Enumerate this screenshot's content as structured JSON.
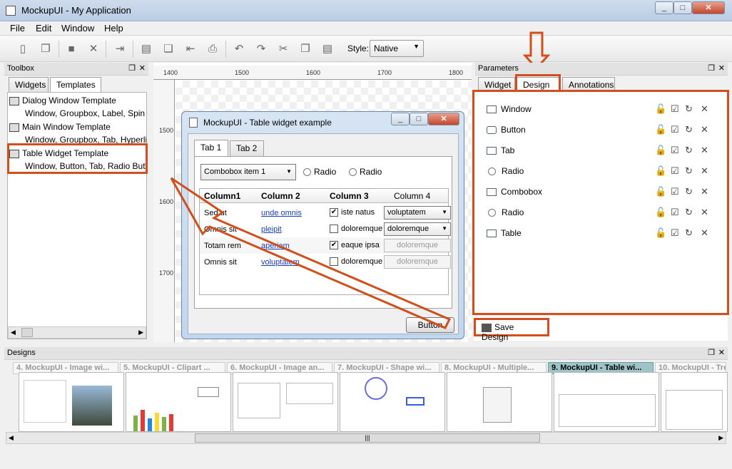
{
  "app": {
    "title": "MockupUI - My Application",
    "window_controls": [
      "_",
      "□",
      "✕"
    ]
  },
  "menu": [
    "File",
    "Edit",
    "Window",
    "Help"
  ],
  "toolbar": {
    "style_label": "Style:",
    "style_value": "Native",
    "icons": [
      "new-icon",
      "copy-icon",
      "save-icon",
      "close-icon",
      "export-icon",
      "paste-icon",
      "clone-icon",
      "import-icon",
      "print-icon",
      "undo-icon",
      "redo-icon",
      "cut-icon",
      "copy-icon",
      "paste-icon"
    ]
  },
  "toolbox": {
    "title": "Toolbox",
    "tabs": [
      "Widgets",
      "Templates"
    ],
    "templates": [
      {
        "name": "Dialog Window Template",
        "desc": "Window, Groupbox, Label, Spin Bo"
      },
      {
        "name": "Main Window Template",
        "desc": "Window, Groupbox, Tab, Hyperlink"
      },
      {
        "name": "Table Widget Template",
        "desc": "Window, Button, Tab, Radio Buttor"
      }
    ]
  },
  "ruler": {
    "h": [
      "1400",
      "1500",
      "1600",
      "1700",
      "1800"
    ],
    "v": [
      "1500",
      "1600",
      "1700"
    ]
  },
  "mock": {
    "title": "MockupUI - Table widget example",
    "tabs": [
      "Tab 1",
      "Tab 2"
    ],
    "combo": "Combobox item 1",
    "radio1": "Radio",
    "radio2": "Radio",
    "columns": [
      "Column1",
      "Column 2",
      "Column 3",
      "Column 4"
    ],
    "rows": [
      {
        "c1": "Sed ut",
        "c2": "unde omnis",
        "c3": "iste natus",
        "c3_checked": true,
        "c4": "voluptatem",
        "c4_enabled": true
      },
      {
        "c1": "Omnis sit",
        "c2": "pleipit",
        "c3": "doloremque",
        "c3_checked": false,
        "c4": "doloremque",
        "c4_enabled": true
      },
      {
        "c1": "Totam rem",
        "c2": "aperiam",
        "c3": "eaque ipsa",
        "c3_checked": true,
        "c4": "doloremque",
        "c4_enabled": false
      },
      {
        "c1": "Omnis sit",
        "c2": "voluptatem",
        "c3": "doloremque",
        "c3_checked": false,
        "c4": "doloremque",
        "c4_enabled": false
      }
    ],
    "button": "Button"
  },
  "parameters": {
    "title": "Parameters",
    "tabs": [
      "Widget",
      "Design",
      "Annotations"
    ],
    "items": [
      "Window",
      "Button",
      "Tab",
      "Radio",
      "Combobox",
      "Radio",
      "Table"
    ],
    "save_label": "Save Design"
  },
  "designs": {
    "title": "Designs",
    "tabs": [
      "4. MockupUI - Image wi...",
      "5. MockupUI - Clipart ...",
      "6. MockupUI - Image an...",
      "7. MockupUI - Shape wi...",
      "8. MockupUI - Multiple...",
      "9. MockupUI - Table wi...",
      "10. MockupUI - Tre"
    ],
    "scroll_grip": "|||"
  },
  "colors": {
    "highlight": "#d14f1d",
    "link": "#1a3dbf",
    "selected_tab": "#9ec4c8"
  }
}
